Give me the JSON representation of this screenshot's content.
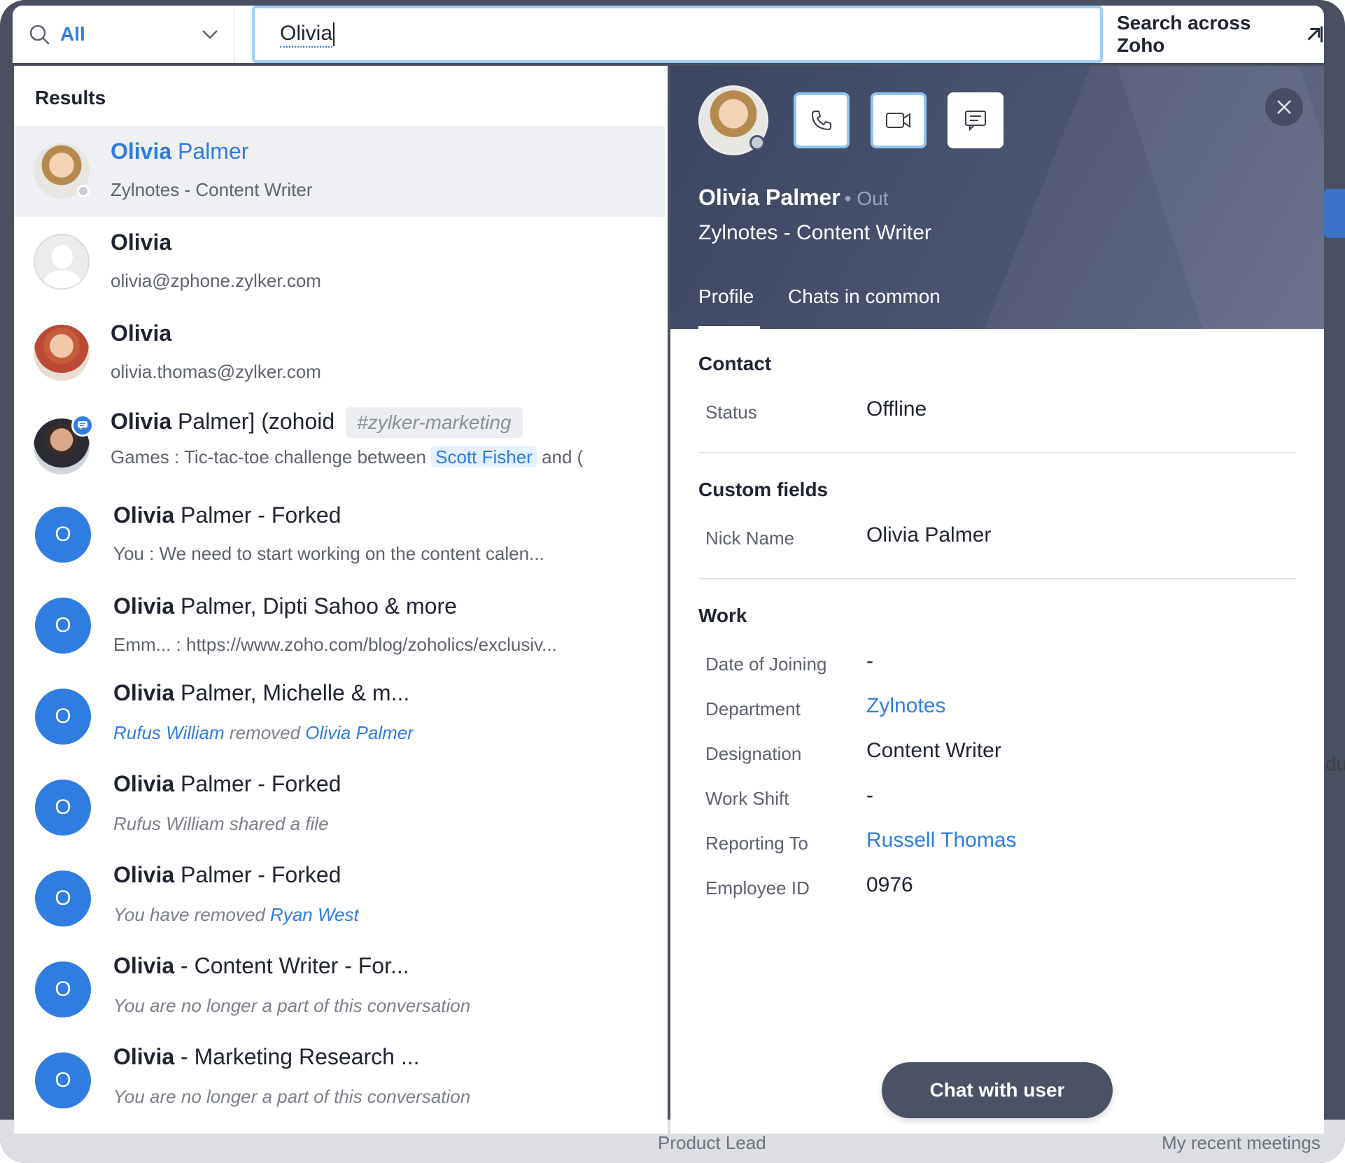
{
  "search": {
    "filter_label": "All",
    "query": "Olivia",
    "across_label": "Search across Zoho"
  },
  "results": {
    "heading": "Results",
    "items": [
      {
        "bold": "Olivia",
        "rest": " Palmer",
        "sub": "Zylnotes - Content Writer"
      },
      {
        "bold": "Olivia",
        "rest": "",
        "sub": "olivia@zphone.zylker.com"
      },
      {
        "bold": "Olivia",
        "rest": "",
        "sub": "olivia.thomas@zylker.com"
      },
      {
        "bold": "Olivia",
        "rest": " Palmer] (zohoid",
        "tag": "#zylker-marketing",
        "sub_pre": "Games : Tic-tac-toe challenge between ",
        "sub_hl": "Scott Fisher",
        "sub_post": " and ("
      },
      {
        "letter": "O",
        "bold": "Olivia",
        "rest": " Palmer - Forked",
        "sub": "You : We need to start working on the content calen..."
      },
      {
        "letter": "O",
        "bold": "Olivia",
        "rest": " Palmer, Dipti Sahoo & more",
        "sub": "Emm...    : https://www.zoho.com/blog/zoholics/exclusiv..."
      },
      {
        "letter": "O",
        "bold": "Olivia",
        "rest": " Palmer, Michelle & m...",
        "sub_link1": "Rufus William",
        "sub_mid": " removed ",
        "sub_link2": "Olivia Palmer"
      },
      {
        "letter": "O",
        "bold": "Olivia",
        "rest": " Palmer - Forked",
        "sub": "Rufus William shared a file"
      },
      {
        "letter": "O",
        "bold": "Olivia",
        "rest": "  Palmer - Forked",
        "sub_pre": "You have removed ",
        "sub_link1": "Ryan West"
      },
      {
        "letter": "O",
        "bold": "Olivia",
        "rest": " - Content Writer - For...",
        "sub": "You are no longer a part of this conversation"
      },
      {
        "letter": "O",
        "bold": "Olivia",
        "rest": " - Marketing Research ...",
        "sub": "You are no longer a part of this conversation"
      }
    ]
  },
  "profile": {
    "name": "Olivia Palmer",
    "status": "• Out",
    "role": "Zylnotes  -  Content Writer",
    "tabs": [
      "Profile",
      "Chats in common"
    ],
    "contact": {
      "title": "Contact",
      "status_label": "Status",
      "status_value": "Offline"
    },
    "custom": {
      "title": "Custom fields",
      "nick_label": "Nick Name",
      "nick_value": "Olivia Palmer"
    },
    "work": {
      "title": "Work",
      "fields": [
        {
          "label": "Date of Joining",
          "value": "-"
        },
        {
          "label": "Department",
          "value": "Zylnotes"
        },
        {
          "label": "Designation",
          "value": "Content Writer"
        },
        {
          "label": "Work Shift",
          "value": "-"
        },
        {
          "label": "Reporting To",
          "value": "Russell Thomas"
        },
        {
          "label": "Employee ID",
          "value": "0976"
        }
      ]
    },
    "chat_button": "Chat with user"
  },
  "background": {
    "text_left": "Product Lead",
    "text_right": "My recent meetings",
    "edge_text": "du"
  },
  "colors": {
    "accent": "#2f7de1",
    "header": "#4a5370",
    "button": "#4a5264"
  },
  "icons": [
    "search-icon",
    "chevron-down-icon",
    "external-link-icon",
    "phone-icon",
    "video-icon",
    "message-icon",
    "close-icon"
  ]
}
